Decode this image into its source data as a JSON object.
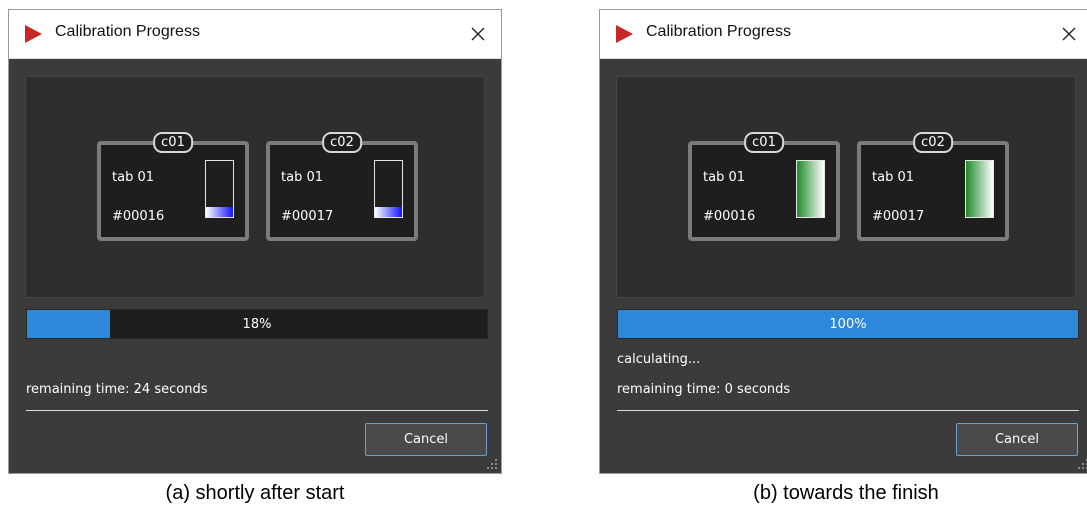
{
  "colors": {
    "dialog_bg": "#3b3b3b",
    "panel_bg": "#2e2e2e",
    "card_bg": "#1e1e1e",
    "progress_fill": "#2d87db",
    "level_blue": "#1414ff",
    "level_green": "#1f8a2a",
    "app_icon_red": "#c62828"
  },
  "dialogs": [
    {
      "title": "Calibration Progress",
      "app_icon": "red-triangle-icon",
      "close_icon": "close-icon",
      "devices": [
        {
          "tag": "c01",
          "tab": "tab 01",
          "serial": "#00016",
          "level": 0.18,
          "level_color": "blue"
        },
        {
          "tag": "c02",
          "tab": "tab 01",
          "serial": "#00017",
          "level": 0.18,
          "level_color": "blue"
        }
      ],
      "progress": {
        "value": 0.18,
        "label": "18%"
      },
      "status": "",
      "remaining": "remaining time: 24 seconds",
      "cancel_label": "Cancel",
      "caption": "(a)  shortly after start"
    },
    {
      "title": "Calibration Progress",
      "app_icon": "red-triangle-icon",
      "close_icon": "close-icon",
      "devices": [
        {
          "tag": "c01",
          "tab": "tab 01",
          "serial": "#00016",
          "level": 1.0,
          "level_color": "green"
        },
        {
          "tag": "c02",
          "tab": "tab 01",
          "serial": "#00017",
          "level": 1.0,
          "level_color": "green"
        }
      ],
      "progress": {
        "value": 1.0,
        "label": "100%"
      },
      "status": "calculating...",
      "remaining": "remaining time: 0 seconds",
      "cancel_label": "Cancel",
      "caption": "(b)  towards the finish"
    }
  ]
}
